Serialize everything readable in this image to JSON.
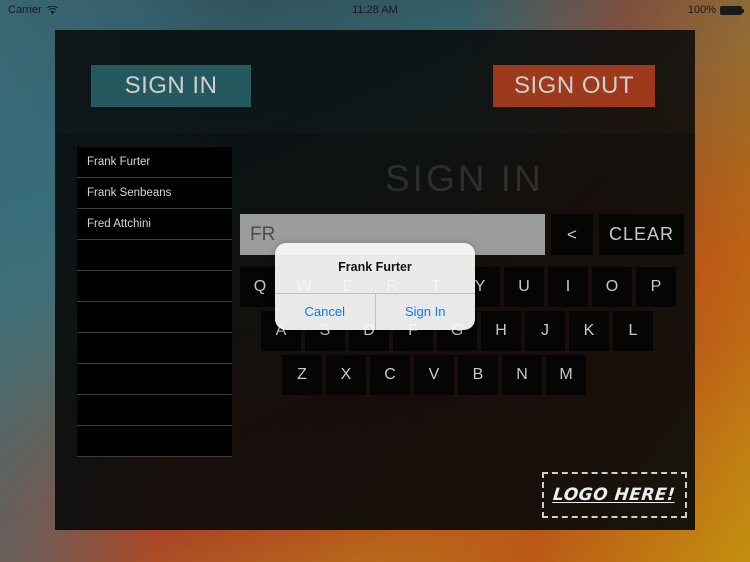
{
  "status_bar": {
    "carrier": "Carrier",
    "wifi_icon": "wifi-icon",
    "time": "11:28 AM",
    "battery_percent": "100%",
    "battery_icon": "battery-full-icon"
  },
  "header": {
    "sign_in_label": "SIGN IN",
    "sign_out_label": "SIGN OUT",
    "sign_in_color": "#245a5e",
    "sign_out_color": "#9c3a1b"
  },
  "main": {
    "page_title": "SIGN IN",
    "name_list": [
      "Frank Furter",
      "Frank Senbeans",
      "Fred Attchini",
      "",
      "",
      "",
      "",
      "",
      "",
      ""
    ],
    "search": {
      "value": "FR",
      "placeholder": "",
      "backspace_label": "<",
      "clear_label": "CLEAR"
    },
    "keyboard": {
      "row1": [
        "Q",
        "W",
        "E",
        "R",
        "T",
        "Y",
        "U",
        "I",
        "O",
        "P"
      ],
      "row2": [
        "A",
        "S",
        "D",
        "F",
        "G",
        "H",
        "J",
        "K",
        "L"
      ],
      "row3": [
        "Z",
        "X",
        "C",
        "V",
        "B",
        "N",
        "M"
      ]
    }
  },
  "footer": {
    "logo_text": "LOGO HERE!"
  },
  "alert": {
    "title": "Frank Furter",
    "cancel_label": "Cancel",
    "confirm_label": "Sign In",
    "accent_color": "#0b7bf1"
  }
}
